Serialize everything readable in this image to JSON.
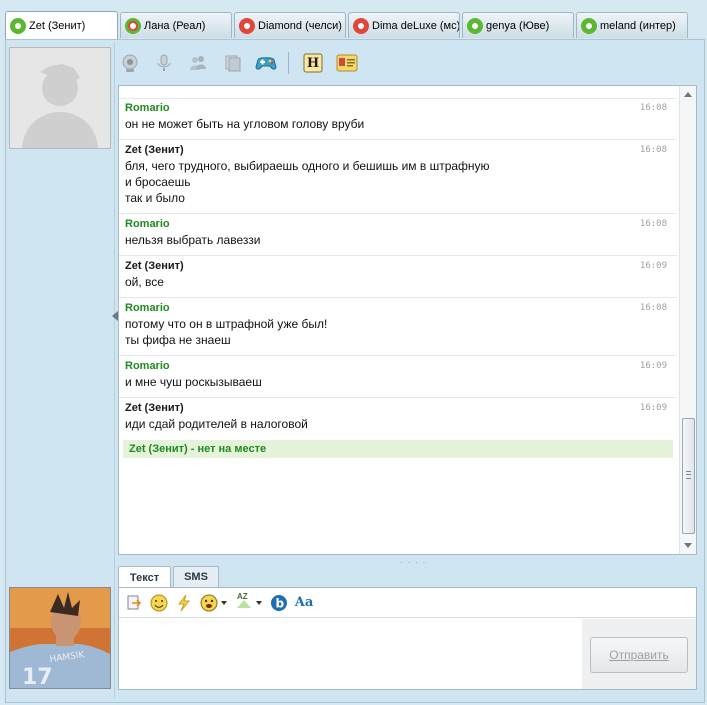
{
  "tabs": [
    {
      "label": "Zet (Зенит)",
      "icon": "flower-green-icon",
      "active": true
    },
    {
      "label": "Лана (Реал)",
      "icon": "flower-mix-icon",
      "active": false
    },
    {
      "label": "Diamond (челси)",
      "icon": "flower-red-icon",
      "active": false
    },
    {
      "label": "Dima deLuxe (мс)",
      "icon": "flower-red-icon",
      "active": false
    },
    {
      "label": "genya (Юве)",
      "icon": "flower-green-icon",
      "active": false
    },
    {
      "label": "meland (интер)",
      "icon": "flower-green-icon",
      "active": false
    }
  ],
  "toolbar": {
    "icons": [
      "webcam-icon",
      "microphone-icon",
      "users-icon",
      "files-icon",
      "gamepad-icon",
      "history-icon",
      "contact-card-icon"
    ],
    "history_letter": "H"
  },
  "messages": [
    {
      "author": "Romario",
      "author_color": "green",
      "time": "16:08",
      "lines": [
        "он не может быть на угловом голову вруби"
      ]
    },
    {
      "author": "Zet (Зенит)",
      "author_color": "black",
      "time": "16:08",
      "lines": [
        "бля, чего трудного, выбираешь одного и бешишь им в штрафную",
        "и бросаешь",
        "так и было"
      ]
    },
    {
      "author": "Romario",
      "author_color": "green",
      "time": "16:08",
      "lines": [
        "нельзя выбрать лавеззи"
      ]
    },
    {
      "author": "Zet (Зенит)",
      "author_color": "black",
      "time": "16:09",
      "lines": [
        "ой, все"
      ]
    },
    {
      "author": "Romario",
      "author_color": "green",
      "time": "16:08",
      "lines": [
        "потому что он в штрафной уже был!",
        "ты фифа не знаеш"
      ]
    },
    {
      "author": "Romario",
      "author_color": "green",
      "time": "16:09",
      "lines": [
        "и мне чуш роскызываеш"
      ]
    },
    {
      "author": "Zet (Зенит)",
      "author_color": "black",
      "time": "16:09",
      "lines": [
        "иди сдай родителей в налоговой"
      ]
    }
  ],
  "status_line": "Zet (Зенит) - нет на месте",
  "input_tabs": [
    {
      "label": "Текст",
      "active": true
    },
    {
      "label": "SMS",
      "active": false
    }
  ],
  "compose": {
    "icons": [
      "send-file-icon",
      "smiley-icon",
      "lightning-icon",
      "animated-smiley-icon",
      "translit-icon",
      "b-icon",
      "font-icon"
    ],
    "translit_label": "AZ",
    "font_label": "Aa",
    "send_label": "Отправить",
    "input_value": ""
  },
  "colors": {
    "author_green": "#1f8a1f",
    "status_bg": "#e4f3da",
    "window_bg": "#d6e9f3"
  }
}
